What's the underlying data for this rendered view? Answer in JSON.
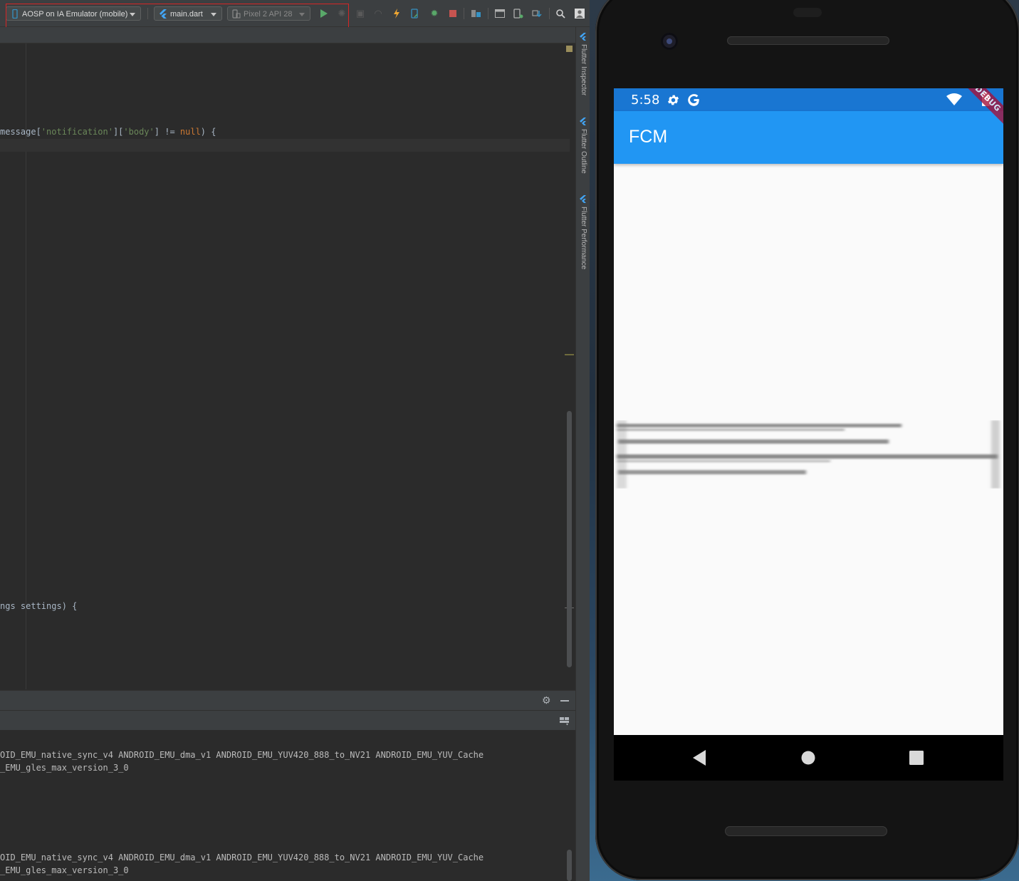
{
  "ide": {
    "toolbar": {
      "device_selector": "AOSP on IA Emulator (mobile)",
      "config_selector": "main.dart",
      "target_selector": "Pixel 2 API 28",
      "icons": [
        "run-icon",
        "debug-icon",
        "profile-icon",
        "attach-icon",
        "hot-reload-icon",
        "hot-restart-icon",
        "debug-bug-icon",
        "stop-icon",
        "project-structure-icon",
        "sdk-manager-icon",
        "avd-manager-icon",
        "sync-icon",
        "search-icon",
        "user-icon"
      ]
    },
    "side_tabs": [
      "Flutter Inspector",
      "Flutter Outline",
      "Flutter Performance"
    ],
    "editor": {
      "line1": {
        "prefix": "message[",
        "s1": "'notification'",
        "mid": "][",
        "s2": "'body'",
        "op": "] != ",
        "kw": "null",
        "suffix": ") {"
      },
      "line2": "ngs settings) {"
    },
    "console": {
      "block1_line1": "OID_EMU_native_sync_v4 ANDROID_EMU_dma_v1 ANDROID_EMU_YUV420_888_to_NV21 ANDROID_EMU_YUV_Cache",
      "block1_line2": "_EMU_gles_max_version_3_0",
      "block2_line1": "OID_EMU_native_sync_v4 ANDROID_EMU_dma_v1 ANDROID_EMU_YUV420_888_to_NV21 ANDROID_EMU_YUV_Cache",
      "block2_line2": "_EMU_gles_max_version_3_0"
    }
  },
  "emulator": {
    "status_bar": {
      "time": "5:58",
      "left_icons": [
        "settings-icon",
        "google-icon"
      ],
      "right_icons": [
        "wifi-icon",
        "battery-icon"
      ]
    },
    "app_bar": {
      "title": "FCM"
    },
    "debug_banner": "DEBUG",
    "nav_buttons": [
      "back-button",
      "home-button",
      "recents-button"
    ],
    "colors": {
      "status_bar": "#1976d2",
      "app_bar": "#2196f3",
      "debug_banner": "#a4133c"
    }
  }
}
